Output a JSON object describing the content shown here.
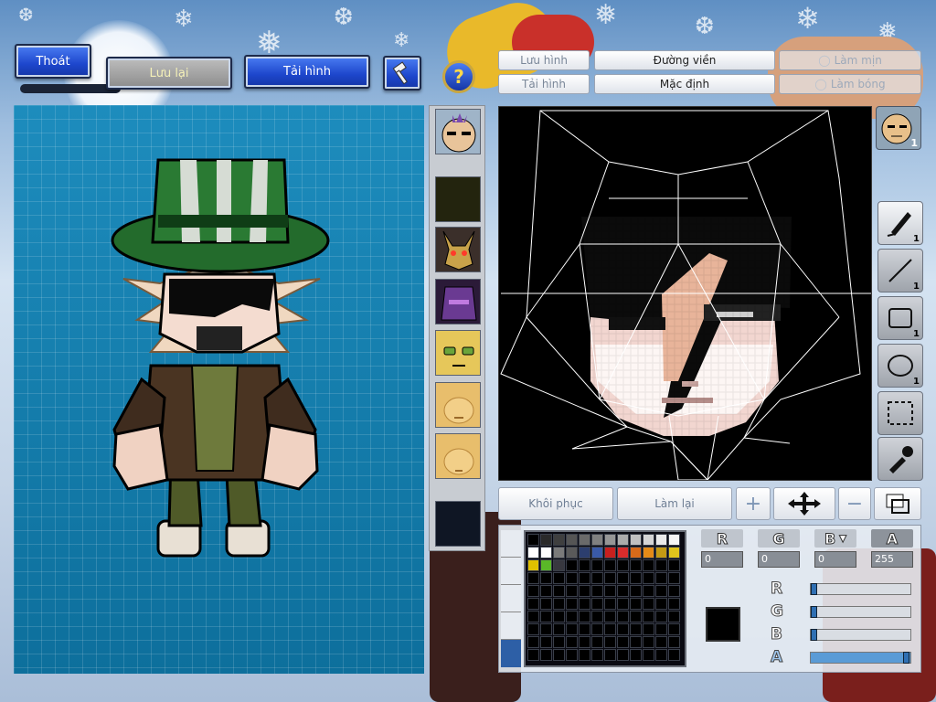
{
  "header": {
    "exit_label": "Thoát",
    "save_label": "Lưu lại",
    "reload_label": "Tải hình",
    "hammer_icon": "hammer-icon",
    "help_icon": "question-icon"
  },
  "mode_tabs": {
    "save_image": "Lưu hình",
    "load_image": "Tải hình",
    "outline": "Đường viền",
    "default": "Mặc định",
    "smooth": "Làm mịn",
    "shadow": "Làm bóng"
  },
  "thumbnails": [
    {
      "name": "face-thumb-1",
      "color": "#d9a778"
    },
    {
      "name": "empty-slot-1",
      "color": "#23240e"
    },
    {
      "name": "monster-thumb",
      "color": "#4d3a2c"
    },
    {
      "name": "purple-thumb",
      "color": "#4b2f5f"
    },
    {
      "name": "yellow-face-thumb",
      "color": "#d9bb52"
    },
    {
      "name": "plain-face-thumb-1",
      "color": "#e2b768"
    },
    {
      "name": "plain-face-thumb-2",
      "color": "#e2b768"
    },
    {
      "name": "empty-slot-2",
      "color": "#0f1624"
    }
  ],
  "tools": [
    {
      "name": "pen-tool",
      "count": "1"
    },
    {
      "name": "line-tool",
      "count": "1"
    },
    {
      "name": "rectangle-tool",
      "count": "1"
    },
    {
      "name": "ellipse-tool",
      "count": "1"
    },
    {
      "name": "select-tool",
      "count": ""
    },
    {
      "name": "eyedropper-tool",
      "count": ""
    }
  ],
  "avatar_count": "1",
  "bottom": {
    "restore_label": "Khôi phục",
    "redo_label": "Làm lại"
  },
  "palette_colors": [
    "#000000",
    "#2a2a2a",
    "#3f3f3f",
    "#555555",
    "#6a6a6a",
    "#808080",
    "#969696",
    "#ababab",
    "#c0c0c0",
    "#d5d5d5",
    "#eaeaea",
    "#f6f6f6",
    "#ffffff",
    "#ffffff",
    "#7a7a7a",
    "#5a5a5a",
    "#2c3e6e",
    "#3a5aa8",
    "#c8201e",
    "#d82c2c",
    "#d86a1a",
    "#e48a18",
    "#c49a14",
    "#e0c41c",
    "#e0c000",
    "#5ab828",
    "#38383f"
  ],
  "color": {
    "r_label": "R",
    "g_label": "G",
    "b_label": "B",
    "a_label": "A",
    "r_value": "0",
    "g_value": "0",
    "b_value": "0",
    "a_value": "255",
    "current": "#000000",
    "r_level": 0,
    "g_level": 0,
    "b_level": 0,
    "a_level": 1.0
  }
}
